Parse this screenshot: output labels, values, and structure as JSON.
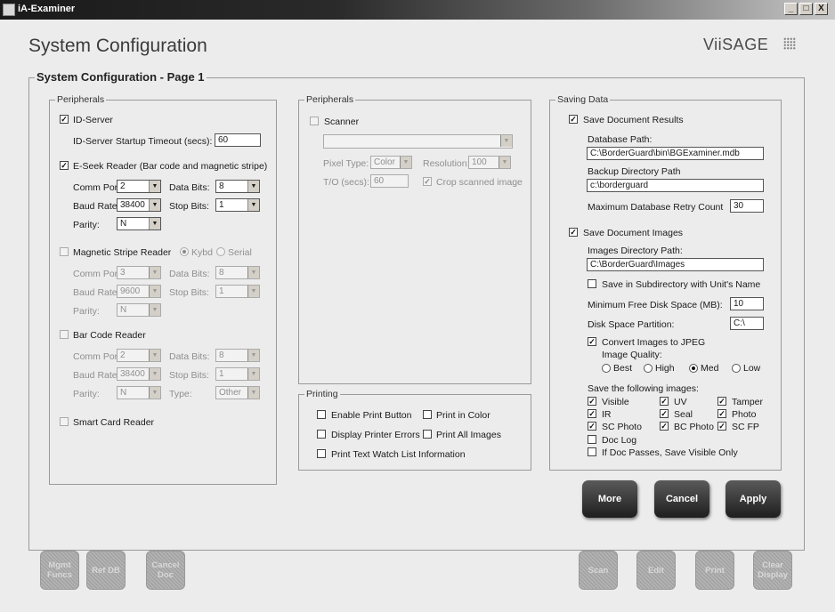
{
  "window": {
    "title": "iA-Examiner",
    "controls": [
      "_",
      "□",
      "X"
    ]
  },
  "page": {
    "title": "System Configuration",
    "brand": "ViiSAGE",
    "section_title": "System Configuration - Page 1"
  },
  "peripherals_left": {
    "title": "Peripherals",
    "id_server": {
      "label": "ID-Server",
      "checked": true,
      "timeout_label": "ID-Server Startup Timeout (secs):",
      "timeout_value": "60"
    },
    "eseek": {
      "label": "E-Seek Reader  (Bar code and magnetic stripe)",
      "checked": true,
      "comm_port_label": "Comm Port:",
      "comm_port": "2",
      "data_bits_label": "Data Bits:",
      "data_bits": "8",
      "baud_rate_label": "Baud Rate:",
      "baud_rate": "38400",
      "stop_bits_label": "Stop Bits:",
      "stop_bits": "1",
      "parity_label": "Parity:",
      "parity": "N"
    },
    "msr": {
      "label": "Magnetic Stripe Reader",
      "checked": false,
      "kybd_label": "Kybd",
      "serial_label": "Serial",
      "comm_port_label": "Comm Port:",
      "comm_port": "3",
      "data_bits_label": "Data Bits:",
      "data_bits": "8",
      "baud_rate_label": "Baud Rate:",
      "baud_rate": "9600",
      "stop_bits_label": "Stop Bits:",
      "stop_bits": "1",
      "parity_label": "Parity:",
      "parity": "N"
    },
    "barcode": {
      "label": "Bar Code Reader",
      "checked": false,
      "comm_port_label": "Comm Port:",
      "comm_port": "2",
      "data_bits_label": "Data Bits:",
      "data_bits": "8",
      "baud_rate_label": "Baud Rate:",
      "baud_rate": "38400",
      "stop_bits_label": "Stop Bits:",
      "stop_bits": "1",
      "parity_label": "Parity:",
      "parity": "N",
      "type_label": "Type:",
      "type": "Other"
    },
    "smartcard": {
      "label": "Smart Card Reader",
      "checked": false
    }
  },
  "peripherals_mid": {
    "title": "Peripherals",
    "scanner": {
      "label": "Scanner",
      "checked": false,
      "device": "",
      "pixel_type_label": "Pixel Type:",
      "pixel_type": "Color",
      "resolution_label": "Resolution:",
      "resolution": "100",
      "to_label": "T/O (secs):",
      "to_value": "60",
      "crop_label": "Crop scanned image",
      "crop_checked": true
    }
  },
  "printing": {
    "title": "Printing",
    "enable_print": "Enable Print Button",
    "print_color": "Print in Color",
    "display_errors": "Display Printer Errors",
    "print_all": "Print All Images",
    "print_watch": "Print Text Watch List Information"
  },
  "saving": {
    "title": "Saving Data",
    "save_results": {
      "label": "Save Document Results",
      "checked": true
    },
    "db_path_label": "Database Path:",
    "db_path": "C:\\BorderGuard\\bin\\BGExaminer.mdb",
    "backup_label": "Backup Directory Path",
    "backup_path": "c:\\borderguard",
    "retry_label": "Maximum Database Retry Count",
    "retry_value": "30",
    "save_images": {
      "label": "Save Document Images",
      "checked": true
    },
    "images_dir_label": "Images Directory Path:",
    "images_dir": "C:\\BorderGuard\\Images",
    "subdir_label": "Save in Subdirectory with Unit's Name",
    "min_space_label": "Minimum Free Disk Space (MB):",
    "min_space": "10",
    "partition_label": "Disk Space Partition:",
    "partition": "C:\\",
    "jpeg_label": "Convert Images to JPEG",
    "quality_label": "Image Quality:",
    "quality_options": [
      "Best",
      "High",
      "Med",
      "Low"
    ],
    "quality_selected": "Med",
    "save_following_label": "Save the following images:",
    "images": [
      {
        "label": "Visible",
        "checked": true
      },
      {
        "label": "UV",
        "checked": true
      },
      {
        "label": "Tamper",
        "checked": true
      },
      {
        "label": "IR",
        "checked": true
      },
      {
        "label": "Seal",
        "checked": true
      },
      {
        "label": "Photo",
        "checked": true
      },
      {
        "label": "SC Photo",
        "checked": true
      },
      {
        "label": "BC Photo",
        "checked": true
      },
      {
        "label": "SC FP",
        "checked": true
      },
      {
        "label": "Doc Log",
        "checked": false
      }
    ],
    "visible_only_label": "If Doc Passes, Save Visible Only"
  },
  "actions": {
    "more": "More",
    "cancel": "Cancel",
    "apply": "Apply"
  },
  "bottom_left": [
    "Mgmt Funcs",
    "Ref DB",
    "Cancel Doc"
  ],
  "bottom_right": [
    "Scan",
    "Edit",
    "Print",
    "Clear Display"
  ]
}
